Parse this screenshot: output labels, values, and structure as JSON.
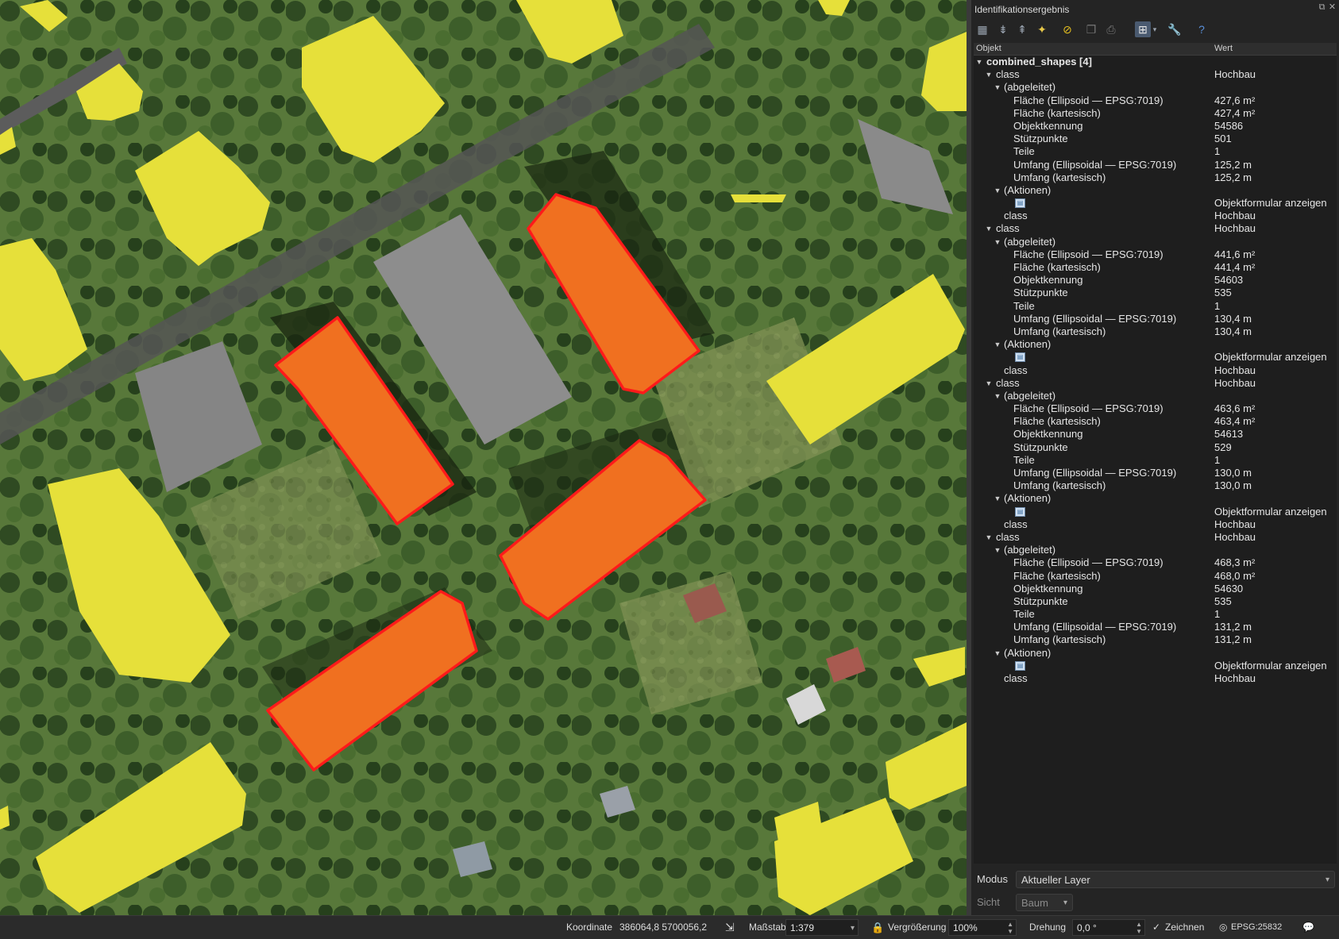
{
  "panel": {
    "title": "Identifikationsergebnis",
    "col_object": "Objekt",
    "col_value": "Wert"
  },
  "toolbar": {
    "icons": [
      "expand-tree-icon",
      "expand-all-icon",
      "collapse-all-icon",
      "highlight-icon",
      "clear-results-icon",
      "copy-icon",
      "print-icon",
      "identify-mode-icon",
      "settings-wrench-icon",
      "help-icon"
    ]
  },
  "results": {
    "root_label": "combined_shapes  [4]",
    "features": [
      {
        "class_key": "class",
        "class_val": "Hochbau",
        "derived_label": "(abgeleitet)",
        "attrs": [
          {
            "k": "Fläche (Ellipsoid — EPSG:7019)",
            "v": "427,6 m²"
          },
          {
            "k": "Fläche (kartesisch)",
            "v": "427,4 m²"
          },
          {
            "k": "Objektkennung",
            "v": "54586"
          },
          {
            "k": "Stützpunkte",
            "v": "501"
          },
          {
            "k": "Teile",
            "v": "1"
          },
          {
            "k": "Umfang (Ellipsoidal — EPSG:7019)",
            "v": "125,2 m"
          },
          {
            "k": "Umfang (kartesisch)",
            "v": "125,2 m"
          }
        ],
        "actions_label": "(Aktionen)",
        "action_val": "Objektformular anzeigen",
        "attr_class_key": "class",
        "attr_class_val": "Hochbau"
      },
      {
        "class_key": "class",
        "class_val": "Hochbau",
        "derived_label": "(abgeleitet)",
        "attrs": [
          {
            "k": "Fläche (Ellipsoid — EPSG:7019)",
            "v": "441,6 m²"
          },
          {
            "k": "Fläche (kartesisch)",
            "v": "441,4 m²"
          },
          {
            "k": "Objektkennung",
            "v": "54603"
          },
          {
            "k": "Stützpunkte",
            "v": "535"
          },
          {
            "k": "Teile",
            "v": "1"
          },
          {
            "k": "Umfang (Ellipsoidal — EPSG:7019)",
            "v": "130,4 m"
          },
          {
            "k": "Umfang (kartesisch)",
            "v": "130,4 m"
          }
        ],
        "actions_label": "(Aktionen)",
        "action_val": "Objektformular anzeigen",
        "attr_class_key": "class",
        "attr_class_val": "Hochbau"
      },
      {
        "class_key": "class",
        "class_val": "Hochbau",
        "derived_label": "(abgeleitet)",
        "attrs": [
          {
            "k": "Fläche (Ellipsoid — EPSG:7019)",
            "v": "463,6 m²"
          },
          {
            "k": "Fläche (kartesisch)",
            "v": "463,4 m²"
          },
          {
            "k": "Objektkennung",
            "v": "54613"
          },
          {
            "k": "Stützpunkte",
            "v": "529"
          },
          {
            "k": "Teile",
            "v": "1"
          },
          {
            "k": "Umfang (Ellipsoidal — EPSG:7019)",
            "v": "130,0 m"
          },
          {
            "k": "Umfang (kartesisch)",
            "v": "130,0 m"
          }
        ],
        "actions_label": "(Aktionen)",
        "action_val": "Objektformular anzeigen",
        "attr_class_key": "class",
        "attr_class_val": "Hochbau"
      },
      {
        "class_key": "class",
        "class_val": "Hochbau",
        "derived_label": "(abgeleitet)",
        "attrs": [
          {
            "k": "Fläche (Ellipsoid — EPSG:7019)",
            "v": "468,3 m²"
          },
          {
            "k": "Fläche (kartesisch)",
            "v": "468,0 m²"
          },
          {
            "k": "Objektkennung",
            "v": "54630"
          },
          {
            "k": "Stützpunkte",
            "v": "535"
          },
          {
            "k": "Teile",
            "v": "1"
          },
          {
            "k": "Umfang (Ellipsoidal — EPSG:7019)",
            "v": "131,2 m"
          },
          {
            "k": "Umfang (kartesisch)",
            "v": "131,2 m"
          }
        ],
        "actions_label": "(Aktionen)",
        "action_val": "Objektformular anzeigen",
        "attr_class_key": "class",
        "attr_class_val": "Hochbau"
      }
    ]
  },
  "options": {
    "mode_label": "Modus",
    "mode_value": "Aktueller Layer",
    "view_label": "Sicht",
    "view_value": "Baum"
  },
  "statusbar": {
    "coord_label": "Koordinate",
    "coord_value": "386064,8  5700056,2",
    "scale_label": "Maßstab",
    "scale_value": "1:379",
    "magnifier_label": "Vergrößerung",
    "magnifier_value": "100%",
    "rotation_label": "Drehung",
    "rotation_value": "0,0 °",
    "render_label": "Zeichnen",
    "crs_value": "EPSG:25832"
  },
  "colors": {
    "selected_fill": "#f07020",
    "selected_outline": "#ff1a1a",
    "building_fill": "#e6e03a",
    "panel_bg": "#242424"
  }
}
